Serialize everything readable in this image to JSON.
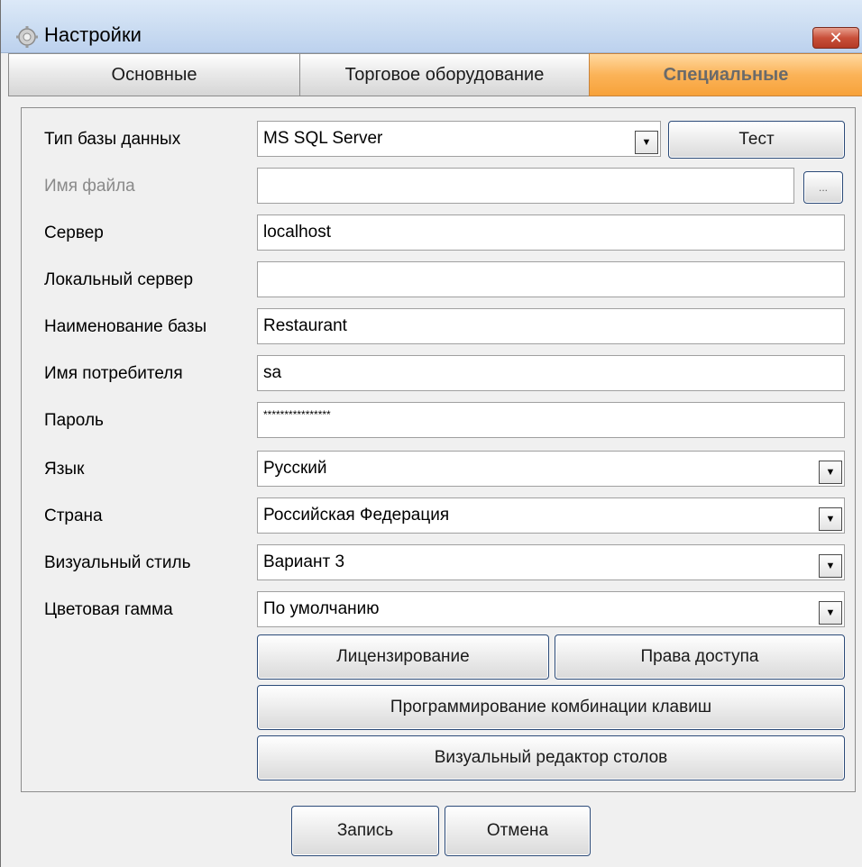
{
  "window": {
    "title": "Настройки",
    "close_label": "✕"
  },
  "tabs": [
    {
      "label": "Основные",
      "active": false
    },
    {
      "label": "Торговое оборудование",
      "active": false
    },
    {
      "label": "Специальные",
      "active": true
    }
  ],
  "form": {
    "db_type": {
      "label": "Тип базы данных",
      "value": "MS SQL Server"
    },
    "test_button": "Тест",
    "file_name": {
      "label": "Имя файла",
      "value": "",
      "browse_label": "..."
    },
    "server": {
      "label": "Сервер",
      "value": "localhost"
    },
    "local_server": {
      "label": "Локальный сервер",
      "value": ""
    },
    "db_name": {
      "label": "Наименование базы",
      "value": "Restaurant"
    },
    "user_name": {
      "label": "Имя потребителя",
      "value": "sa"
    },
    "password": {
      "label": "Пароль",
      "value": "****************"
    },
    "language": {
      "label": "Язык",
      "value": "Русский"
    },
    "country": {
      "label": "Страна",
      "value": "Российская Федерация"
    },
    "visual_style": {
      "label": "Визуальный стиль",
      "value": "Вариант 3"
    },
    "color_scheme": {
      "label": "Цветовая гамма",
      "value": "По умолчанию"
    }
  },
  "actions": {
    "licensing": "Лицензирование",
    "access_rights": "Права доступа",
    "hotkeys": "Программирование комбинации клавиш",
    "table_editor": "Визуальный редактор столов"
  },
  "footer": {
    "save": "Запись",
    "cancel": "Отмена"
  },
  "colors": {
    "active_tab": "#fbb358",
    "titlebar": "#c9dbf1",
    "close_button": "#c9503a"
  },
  "icons": {
    "app": "settings-gear-icon",
    "dropdown": "chevron-down-icon",
    "close": "close-icon"
  }
}
